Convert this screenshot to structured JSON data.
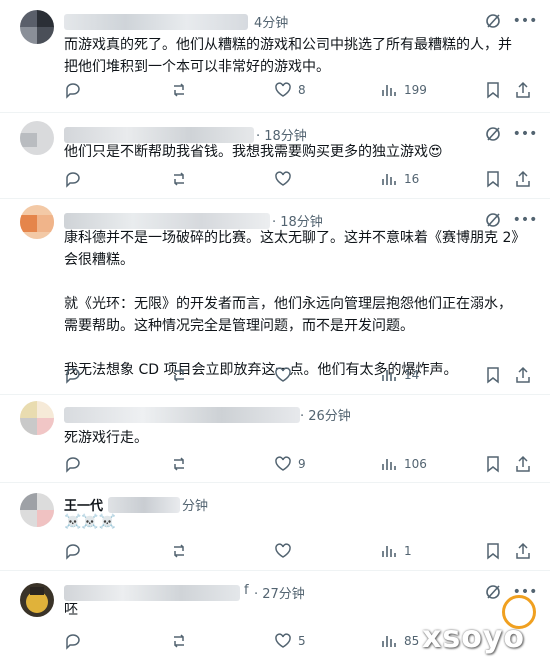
{
  "posts": [
    {
      "time": "4分钟",
      "paragraphs": [
        "而游戏真的死了。他们从糟糕的游戏和公司中挑选了所有最糟糕的人，并把他们堆积到一个本可以非常好的游戏中。"
      ],
      "replies": "",
      "reposts": "",
      "likes": "8",
      "views": "199"
    },
    {
      "time": "· 18分钟",
      "paragraphs": [
        "他们只是不断帮助我省钱。我想我需要购买更多的独立游戏😍"
      ],
      "replies": "",
      "reposts": "",
      "likes": "",
      "views": "16"
    },
    {
      "time": "· 18分钟",
      "paragraphs": [
        "康科德并不是一场破碎的比赛。这太无聊了。这并不意味着《赛博朋克 2》会很糟糕。",
        "就《光环：无限》的开发者而言，他们永远向管理层抱怨他们正在溺水，需要帮助。这种情况完全是管理问题，而不是开发问题。",
        "我无法想象 CD 项目会立即放弃这一点。他们有太多的爆炸声。"
      ],
      "replies": "",
      "reposts": "",
      "likes": "",
      "views": "14"
    },
    {
      "time": "· 26分钟",
      "paragraphs": [
        "死游戏行走。"
      ],
      "replies": "",
      "reposts": "",
      "likes": "9",
      "views": "106"
    },
    {
      "name_fragment": "王一代",
      "time": "分钟",
      "paragraphs": [
        "☠️☠️☠️"
      ],
      "replies": "",
      "reposts": "",
      "likes": "",
      "views": "1"
    },
    {
      "name_fragment": "f",
      "time": "· 27分钟",
      "paragraphs": [
        "呸"
      ],
      "replies": "",
      "reposts": "",
      "likes": "5",
      "views": "85"
    }
  ],
  "watermark": "xsoyo",
  "colors": {
    "text": "#0f1419",
    "muted": "#536471",
    "border": "#eff3f4",
    "blur": "#d7dbe0"
  }
}
